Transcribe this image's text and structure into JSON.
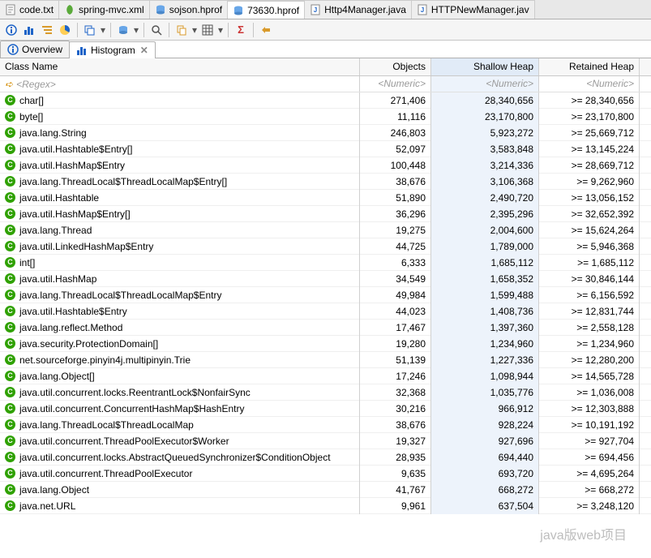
{
  "editor_tabs": [
    {
      "label": "code.txt",
      "icon": "text",
      "active": false
    },
    {
      "label": "spring-mvc.xml",
      "icon": "leaf",
      "active": false
    },
    {
      "label": "sojson.hprof",
      "icon": "db",
      "active": false
    },
    {
      "label": "73630.hprof",
      "icon": "db",
      "active": true
    },
    {
      "label": "Http4Manager.java",
      "icon": "java",
      "active": false
    },
    {
      "label": "HTTPNewManager.java",
      "icon": "java",
      "active": false,
      "truncated": true
    }
  ],
  "inner_tabs": [
    {
      "label": "Overview",
      "icon": "info",
      "active": false
    },
    {
      "label": "Histogram",
      "icon": "histo",
      "active": true
    }
  ],
  "columns": {
    "class_name": "Class Name",
    "objects": "Objects",
    "shallow": "Shallow Heap",
    "retained": "Retained Heap"
  },
  "filter": {
    "regex": "<Regex>",
    "numeric": "<Numeric>"
  },
  "rows": [
    {
      "name": "char[]",
      "objects": "271,406",
      "shallow": "28,340,656",
      "retained": ">= 28,340,656"
    },
    {
      "name": "byte[]",
      "objects": "11,116",
      "shallow": "23,170,800",
      "retained": ">= 23,170,800"
    },
    {
      "name": "java.lang.String",
      "objects": "246,803",
      "shallow": "5,923,272",
      "retained": ">= 25,669,712"
    },
    {
      "name": "java.util.Hashtable$Entry[]",
      "objects": "52,097",
      "shallow": "3,583,848",
      "retained": ">= 13,145,224"
    },
    {
      "name": "java.util.HashMap$Entry",
      "objects": "100,448",
      "shallow": "3,214,336",
      "retained": ">= 28,669,712"
    },
    {
      "name": "java.lang.ThreadLocal$ThreadLocalMap$Entry[]",
      "objects": "38,676",
      "shallow": "3,106,368",
      "retained": ">= 9,262,960"
    },
    {
      "name": "java.util.Hashtable",
      "objects": "51,890",
      "shallow": "2,490,720",
      "retained": ">= 13,056,152"
    },
    {
      "name": "java.util.HashMap$Entry[]",
      "objects": "36,296",
      "shallow": "2,395,296",
      "retained": ">= 32,652,392"
    },
    {
      "name": "java.lang.Thread",
      "objects": "19,275",
      "shallow": "2,004,600",
      "retained": ">= 15,624,264"
    },
    {
      "name": "java.util.LinkedHashMap$Entry",
      "objects": "44,725",
      "shallow": "1,789,000",
      "retained": ">= 5,946,368"
    },
    {
      "name": "int[]",
      "objects": "6,333",
      "shallow": "1,685,112",
      "retained": ">= 1,685,112"
    },
    {
      "name": "java.util.HashMap",
      "objects": "34,549",
      "shallow": "1,658,352",
      "retained": ">= 30,846,144"
    },
    {
      "name": "java.lang.ThreadLocal$ThreadLocalMap$Entry",
      "objects": "49,984",
      "shallow": "1,599,488",
      "retained": ">= 6,156,592"
    },
    {
      "name": "java.util.Hashtable$Entry",
      "objects": "44,023",
      "shallow": "1,408,736",
      "retained": ">= 12,831,744"
    },
    {
      "name": "java.lang.reflect.Method",
      "objects": "17,467",
      "shallow": "1,397,360",
      "retained": ">= 2,558,128"
    },
    {
      "name": "java.security.ProtectionDomain[]",
      "objects": "19,280",
      "shallow": "1,234,960",
      "retained": ">= 1,234,960"
    },
    {
      "name": "net.sourceforge.pinyin4j.multipinyin.Trie",
      "objects": "51,139",
      "shallow": "1,227,336",
      "retained": ">= 12,280,200"
    },
    {
      "name": "java.lang.Object[]",
      "objects": "17,246",
      "shallow": "1,098,944",
      "retained": ">= 14,565,728"
    },
    {
      "name": "java.util.concurrent.locks.ReentrantLock$NonfairSync",
      "objects": "32,368",
      "shallow": "1,035,776",
      "retained": ">= 1,036,008"
    },
    {
      "name": "java.util.concurrent.ConcurrentHashMap$HashEntry",
      "objects": "30,216",
      "shallow": "966,912",
      "retained": ">= 12,303,888"
    },
    {
      "name": "java.lang.ThreadLocal$ThreadLocalMap",
      "objects": "38,676",
      "shallow": "928,224",
      "retained": ">= 10,191,192"
    },
    {
      "name": "java.util.concurrent.ThreadPoolExecutor$Worker",
      "objects": "19,327",
      "shallow": "927,696",
      "retained": ">= 927,704"
    },
    {
      "name": "java.util.concurrent.locks.AbstractQueuedSynchronizer$ConditionObject",
      "objects": "28,935",
      "shallow": "694,440",
      "retained": ">= 694,456"
    },
    {
      "name": "java.util.concurrent.ThreadPoolExecutor",
      "objects": "9,635",
      "shallow": "693,720",
      "retained": ">= 4,695,264"
    },
    {
      "name": "java.lang.Object",
      "objects": "41,767",
      "shallow": "668,272",
      "retained": ">= 668,272"
    },
    {
      "name": "java.net.URL",
      "objects": "9,961",
      "shallow": "637,504",
      "retained": ">= 3,248,120"
    }
  ],
  "watermark": "java版web项目",
  "toolbar_icons": [
    "info",
    "histo",
    "tree",
    "pie",
    "stack",
    "db",
    "search",
    "copy",
    "grid",
    "sigma",
    "nav"
  ]
}
